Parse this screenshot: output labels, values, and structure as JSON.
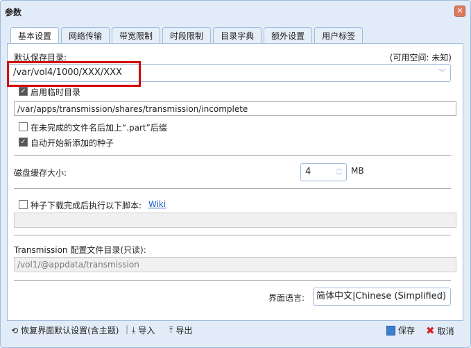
{
  "window": {
    "title": "参数"
  },
  "tabs": [
    "基本设置",
    "网络传输",
    "带宽限制",
    "时段限制",
    "目录字典",
    "额外设置",
    "用户标签"
  ],
  "main": {
    "download_dir_label": "默认保存目录:",
    "free_space": "(可用空间: 未知)",
    "download_dir_value": "/var/vol4/1000/XXX/XXX",
    "incomplete_enabled_label": "启用临时目录",
    "incomplete_enabled": true,
    "incomplete_dir_value": "/var/apps/transmission/shares/transmission/incomplete",
    "rename_partial_label": "在未完成的文件名后加上“.part”后缀",
    "rename_partial": false,
    "start_added_label": "自动开始新添加的种子",
    "start_added": true,
    "cache_label": "磁盘缓存大小:",
    "cache_value": "4",
    "cache_unit": "MB",
    "script_label": "种子下载完成后执行以下脚本:",
    "script_enabled": false,
    "wiki_link": "Wiki",
    "script_value": "",
    "config_dir_label": "Transmission 配置文件目录(只读):",
    "config_dir_value": "/vol1/@appdata/transmission",
    "language_label": "界面语言:",
    "language_value": "简体中文|Chinese (Simplified)"
  },
  "footer": {
    "reset": "恢复界面默认设置(含主题)",
    "import": "导入",
    "export": "导出",
    "save": "保存",
    "cancel": "取消"
  },
  "colors": {
    "highlight": "#d40000",
    "link": "#1a5fc8"
  }
}
